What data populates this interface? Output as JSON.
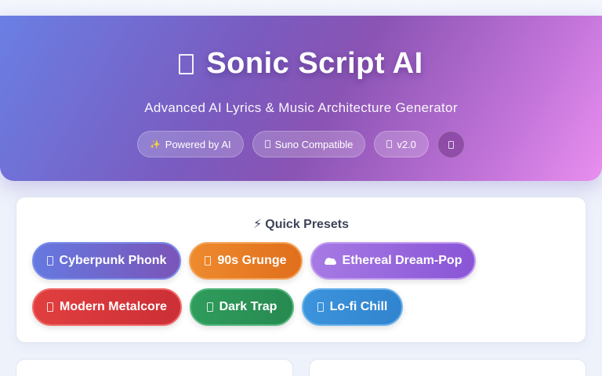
{
  "header": {
    "title": "Sonic Script AI",
    "title_icon": "missing-glyph-icon",
    "subtitle": "Advanced AI Lyrics & Music Architecture Generator",
    "gradient": [
      "#6a7fe4",
      "#8a54b4",
      "#e98ff0"
    ],
    "badges": [
      {
        "icon": "sparkles-icon",
        "label": "Powered by AI"
      },
      {
        "icon": "music-note-icon",
        "label": "Suno Compatible"
      },
      {
        "icon": "tag-icon",
        "label": "v2.0"
      }
    ],
    "settings_icon": "theme-toggle-icon"
  },
  "presets": {
    "title": "Quick Presets",
    "title_icon": "lightning-bolt-icon",
    "items": [
      {
        "label": "Cyberpunk Phonk",
        "icon": "robot-icon",
        "color": "#6579e0"
      },
      {
        "label": "90s Grunge",
        "icon": "guitar-icon",
        "color": "#ee8a2e"
      },
      {
        "label": "Ethereal Dream-Pop",
        "icon": "cloud-icon",
        "color": "#a67ae4"
      },
      {
        "label": "Modern Metalcore",
        "icon": "skull-icon",
        "color": "#e13f3f"
      },
      {
        "label": "Dark Trap",
        "icon": "moon-icon",
        "color": "#2f9c5c"
      },
      {
        "label": "Lo-fi Chill",
        "icon": "coffee-icon",
        "color": "#3c94dc"
      }
    ]
  }
}
